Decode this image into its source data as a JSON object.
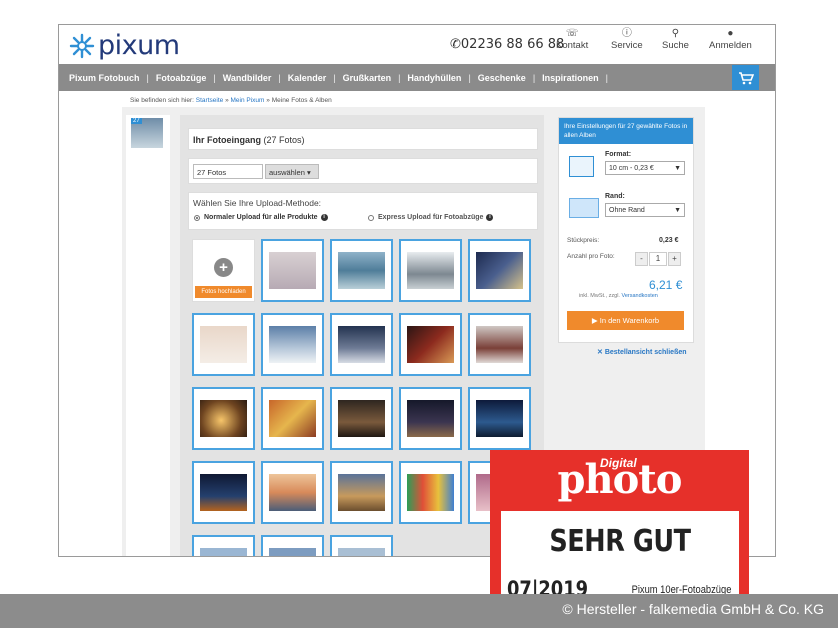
{
  "header": {
    "brand": "pixum",
    "phone": "02236 88 66 88",
    "nav": [
      {
        "label": "Kontakt",
        "icon": "phone-icon"
      },
      {
        "label": "Service",
        "icon": "help-icon"
      },
      {
        "label": "Suche",
        "icon": "search-icon"
      },
      {
        "label": "Anmelden",
        "icon": "user-icon"
      }
    ]
  },
  "menu": {
    "items": [
      "Pixum Fotobuch",
      "Fotoabzüge",
      "Wandbilder",
      "Kalender",
      "Grußkarten",
      "Handyhüllen",
      "Geschenke",
      "Inspirationen"
    ],
    "separator": "|",
    "cart_icon": "cart-icon"
  },
  "breadcrumb": {
    "prefix": "Sie befinden sich hier:",
    "links": [
      "Startseite",
      "Mein Pixum"
    ],
    "current": "Meine Fotos & Alben",
    "sep": "»"
  },
  "sidebar": {
    "thumb_badge": "27"
  },
  "main": {
    "title": "Ihr Fotoeingang",
    "count": "(27 Fotos)",
    "select_value": "27 Fotos",
    "select_action": "auswählen",
    "upload_title": "Wählen Sie Ihre Upload-Methode:",
    "upload_options": [
      "Normaler Upload für alle Produkte",
      "Express Upload für Fotoabzüge"
    ],
    "add_button": "Fotos hochladen"
  },
  "order": {
    "header": "Ihre Einstellungen für 27 gewählte Fotos in allen Alben",
    "format_label": "Format:",
    "format_value": "10 cm - 0,23 €",
    "rand_label": "Rand:",
    "rand_value": "Ohne Rand",
    "unit_price_label": "Stückpreis:",
    "unit_price": "0,23 €",
    "qty_label": "Anzahl pro Foto:",
    "qty_minus": "-",
    "qty_value": "1",
    "qty_plus": "+",
    "total": "6,21 €",
    "vat_text": "inkl. MwSt., zzgl.",
    "vat_link": "Versandkosten",
    "cart_button": "In den Warenkorb",
    "close_link": "Bestellansicht schließen"
  },
  "award": {
    "small": "Digital",
    "big": "photo",
    "rating": "SEHR GUT",
    "date": "07|2019",
    "product": "Pixum 10er-Fotoabzüge"
  },
  "copyright": "© Hersteller - falkemedia GmbH & Co. KG"
}
